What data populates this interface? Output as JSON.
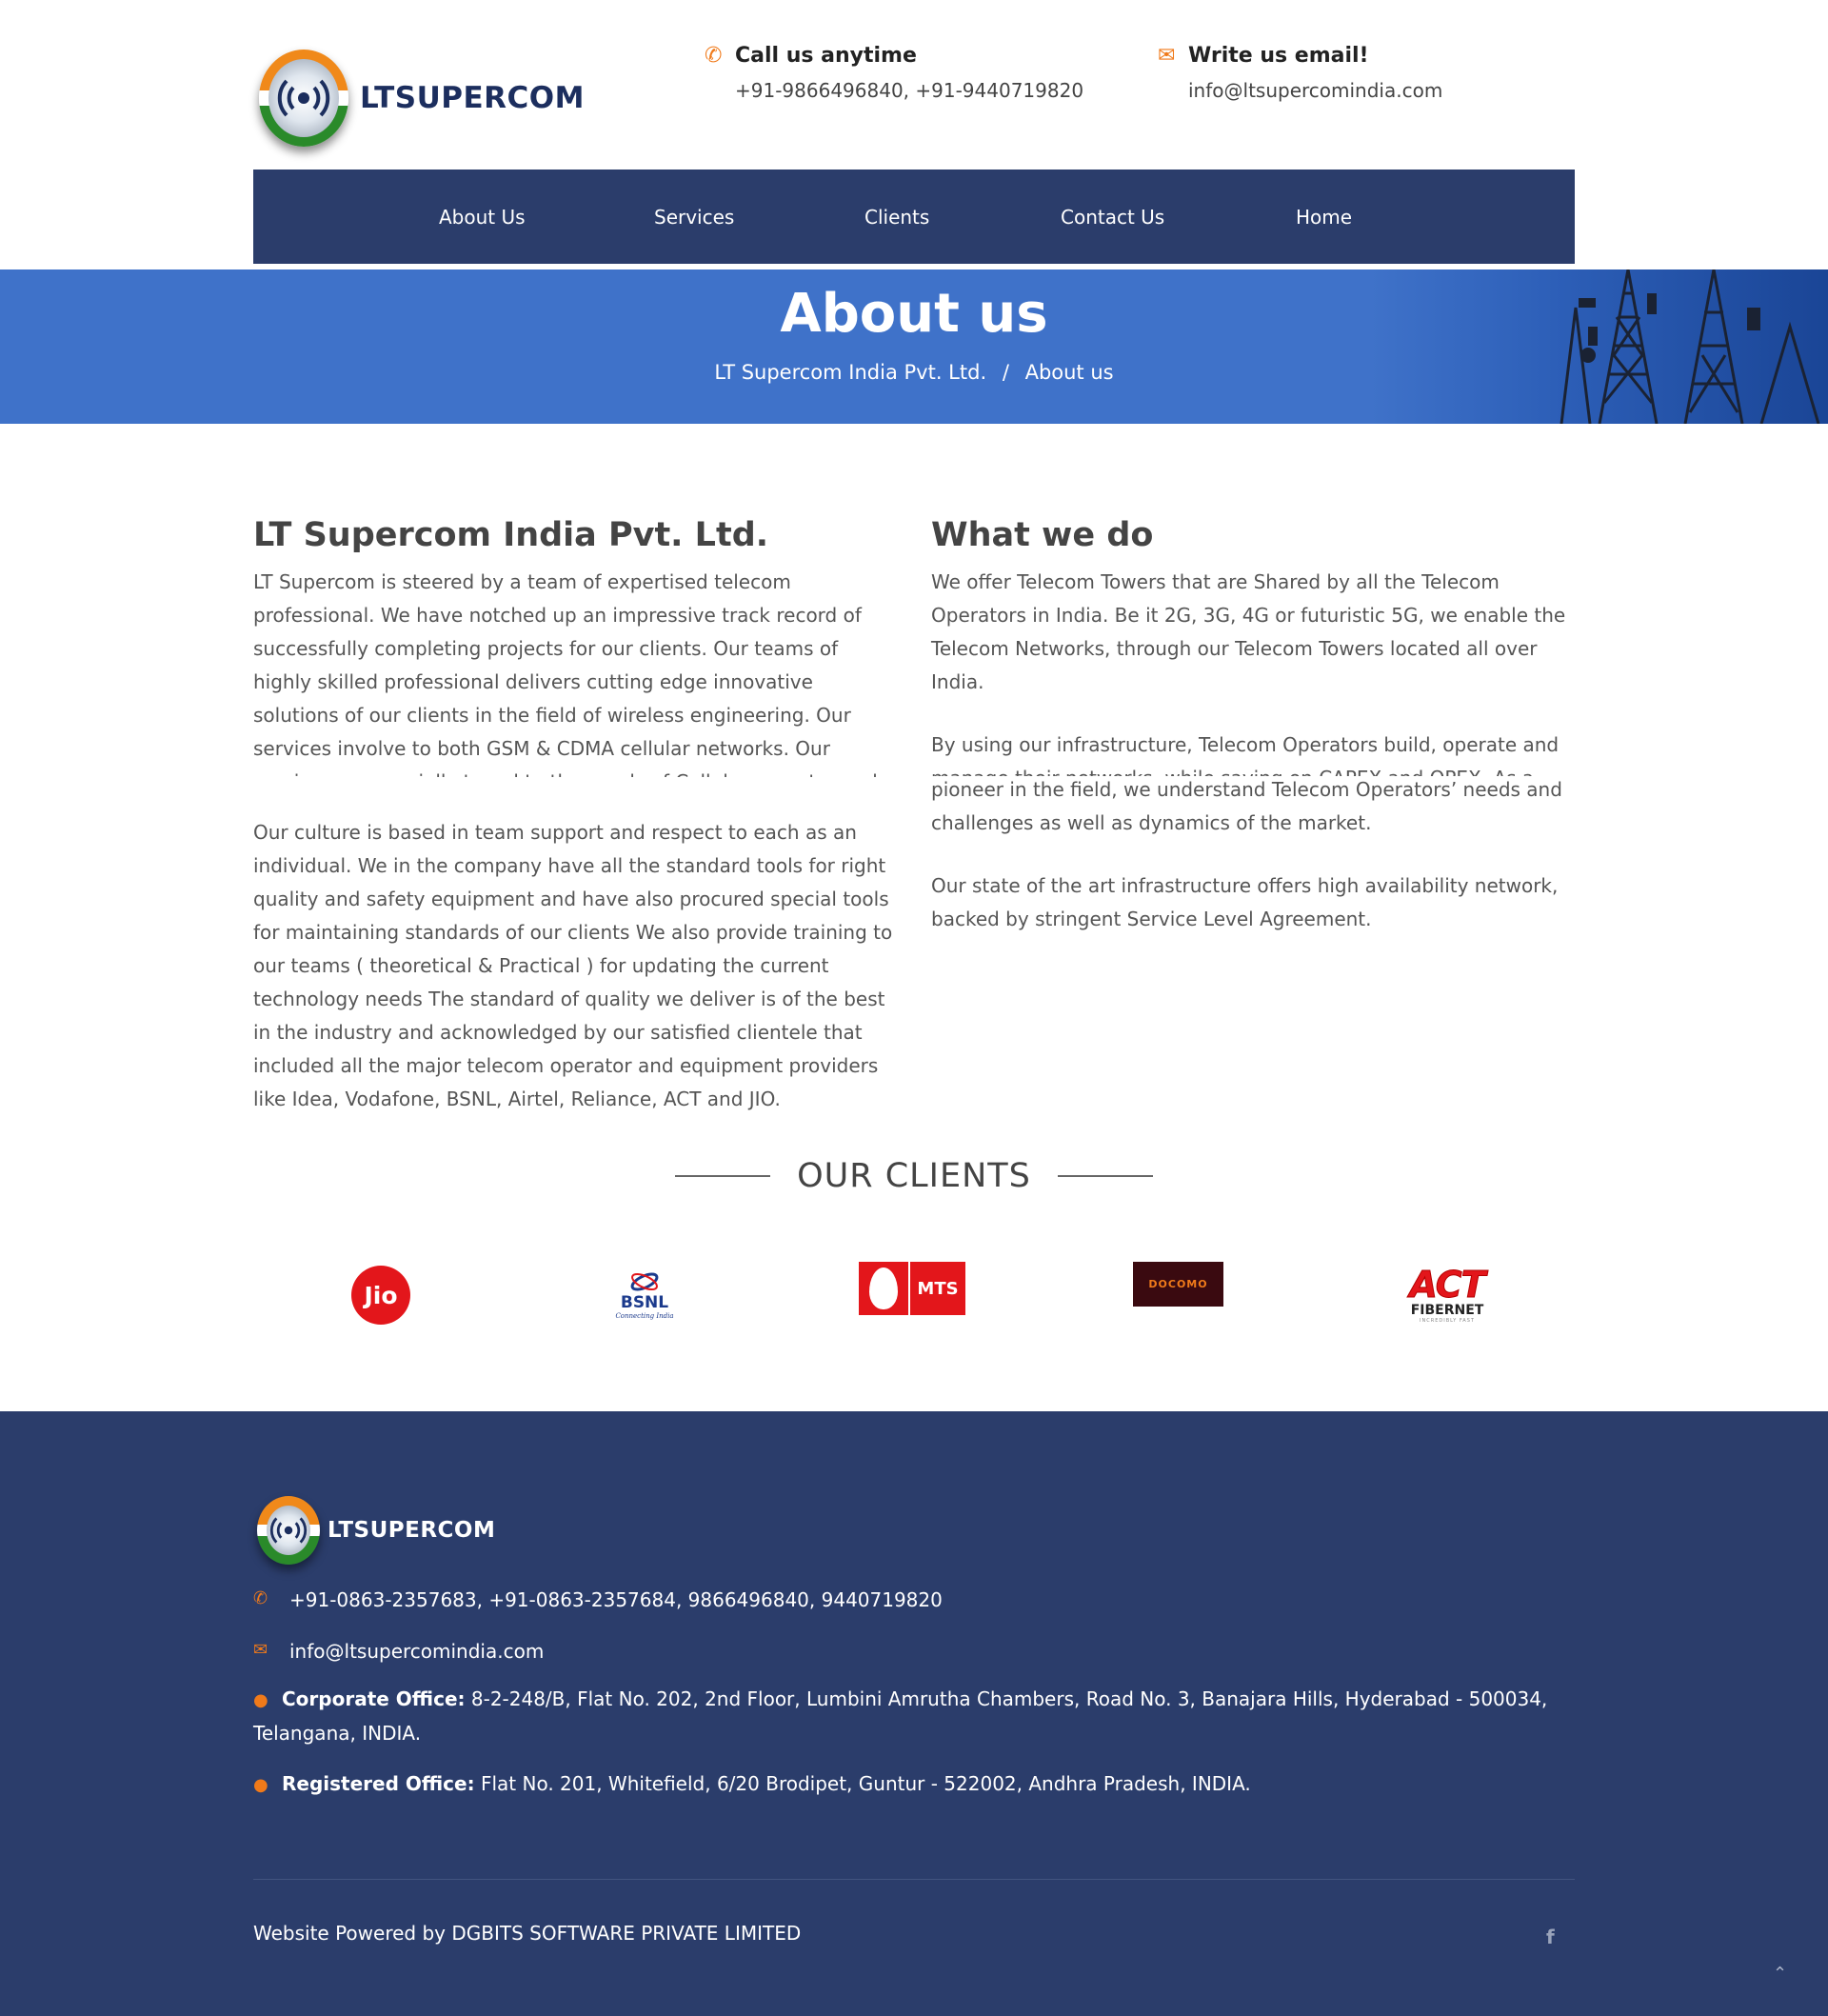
{
  "header": {
    "logo_text": "LTSUPERCOM",
    "call_title": "Call us anytime",
    "call_value": "+91-9866496840, +91-9440719820",
    "email_title": "Write us email!",
    "email_value": "info@ltsupercomindia.com"
  },
  "nav": {
    "items": [
      "About Us",
      "Services",
      "Clients",
      "Contact Us",
      "Home"
    ]
  },
  "banner": {
    "title": "About us",
    "crumb_home": "LT Supercom India Pvt. Ltd.",
    "crumb_sep": "/",
    "crumb_current": "About us"
  },
  "left_col": {
    "heading": "LT Supercom India Pvt. Ltd.",
    "para1": "LT Supercom is steered by a team of expertised telecom professional. We have notched up an impressive track record of successfully completing projects for our clients. Our teams of highly skilled professional delivers cutting edge innovative solutions of our clients in the field of wireless engineering. Our services involve to both GSM & CDMA cellular networks. Our services are specially tuned to the needs of Cellular operator and Basic Service providers.",
    "para2": "Our culture is based in team support and respect to each as an individual. We in the company have all the standard tools for right quality and safety equipment and have also procured special tools for maintaining standards of our clients We also provide training to our teams ( theoretical & Practical ) for updating the current technology needs The standard of quality we deliver is of the best in the industry and acknowledged by our satisfied clientele that included all the major telecom operator and equipment providers like Idea, Vodafone, BSNL, Airtel, Reliance, ACT and JIO."
  },
  "right_col": {
    "heading": "What we do",
    "para1": "We offer Telecom Towers that are Shared by all the Telecom Operators in India. Be it 2G, 3G, 4G or futuristic 5G, we enable the Telecom Networks, through our Telecom Towers located all over India.",
    "para2a": "By using our infrastructure, Telecom Operators build, operate and manage their networks, while saving on CAPEX and OPEX. As a",
    "para2b": "pioneer in the field, we understand Telecom Operators’ needs and challenges as well as dynamics of the market.",
    "para3": "Our state of the art infrastructure offers high availability network, backed by stringent Service Level Agreement."
  },
  "clients": {
    "title": "OUR CLIENTS",
    "logos": [
      {
        "name": "jio",
        "text": "Jio",
        "color": "#e3161b"
      },
      {
        "name": "bsnl",
        "text": "BSNL",
        "sub": "Connecting India",
        "color": "#1b3a8c"
      },
      {
        "name": "mts",
        "text": "MTS",
        "color": "#e3161b"
      },
      {
        "name": "docomo",
        "text": "DOCOMO",
        "color": "#5a0a14"
      },
      {
        "name": "act",
        "text": "ACT",
        "sub": "FIBERNET",
        "tagline": "INCREDIBLY FAST",
        "color": "#e3161b"
      }
    ]
  },
  "footer": {
    "logo_text": "LTSUPERCOM",
    "phone": "+91-0863-2357683, +91-0863-2357684, 9866496840, 9440719820",
    "email": "info@ltsupercomindia.com",
    "corp_label": "Corporate Office:",
    "corp_address": " 8-2-248/B, Flat No. 202, 2nd Floor, Lumbini Amrutha Chambers, Road No. 3, Banajara Hills, Hyderabad - 500034, Telangana, INDIA.",
    "reg_label": "Registered Office:",
    "reg_address": " Flat No. 201, Whitefield, 6/20 Brodipet, Guntur - 522002, Andhra Pradesh, INDIA.",
    "powered": "Website Powered by DGBITS SOFTWARE PRIVATE LIMITED",
    "social": "f"
  },
  "colors": {
    "nav_bg": "#2b3d6b",
    "banner_bg": "#3f72c9",
    "accent": "#f07a1a",
    "footer_bg": "#2b3d6b"
  },
  "icons": [
    "phone-icon",
    "envelope-icon",
    "map-marker-icon",
    "facebook-icon",
    "chevron-up-icon"
  ]
}
